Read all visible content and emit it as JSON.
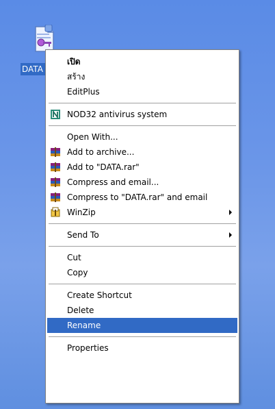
{
  "desktop": {
    "file_icon_label": "DATA",
    "icon_name": "document-with-key-icon"
  },
  "menu": {
    "items": [
      {
        "label": "เปิด",
        "bold": true
      },
      {
        "label": "สร้าง"
      },
      {
        "label": "EditPlus"
      },
      {
        "separator": true
      },
      {
        "label": "NOD32 antivirus system",
        "icon": "nod32-icon"
      },
      {
        "separator": true
      },
      {
        "label": "Open With..."
      },
      {
        "label": "Add to archive...",
        "icon": "winrar-icon"
      },
      {
        "label": "Add to \"DATA.rar\"",
        "icon": "winrar-icon"
      },
      {
        "label": "Compress and email...",
        "icon": "winrar-icon"
      },
      {
        "label": "Compress to \"DATA.rar\" and email",
        "icon": "winrar-icon"
      },
      {
        "label": "WinZip",
        "icon": "winzip-icon",
        "submenu": true
      },
      {
        "separator": true
      },
      {
        "label": "Send To",
        "submenu": true
      },
      {
        "separator": true
      },
      {
        "label": "Cut"
      },
      {
        "label": "Copy"
      },
      {
        "separator": true
      },
      {
        "label": "Create Shortcut"
      },
      {
        "label": "Delete"
      },
      {
        "label": "Rename",
        "selected": true
      },
      {
        "separator": true
      },
      {
        "label": "Properties"
      }
    ]
  },
  "colors": {
    "selection": "#316ac5",
    "desktop": "#6b96e8"
  }
}
